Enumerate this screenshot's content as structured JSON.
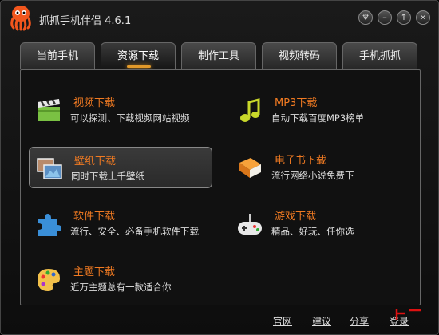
{
  "window": {
    "title": "抓抓手机伴侣 4.6.1"
  },
  "titlebar": {
    "buttons": [
      {
        "name": "skin-button",
        "glyph": "♆"
      },
      {
        "name": "minimize-button",
        "glyph": "–"
      },
      {
        "name": "menu-button",
        "glyph": "↑"
      },
      {
        "name": "close-button",
        "glyph": "×"
      }
    ]
  },
  "tabs": [
    {
      "label": "当前手机"
    },
    {
      "label": "资源下载",
      "active": true
    },
    {
      "label": "制作工具"
    },
    {
      "label": "视频转码"
    },
    {
      "label": "手机抓抓"
    }
  ],
  "items": [
    {
      "title": "视频下载",
      "desc": "可以探测、下载视频网站视频",
      "icon": "clapperboard-icon"
    },
    {
      "title": "MP3下载",
      "desc": "自动下载百度MP3榜单",
      "icon": "music-note-icon"
    },
    {
      "title": "壁纸下载",
      "desc": "同时下载上千壁纸",
      "icon": "wallpaper-icon",
      "selected": true
    },
    {
      "title": "电子书下载",
      "desc": "流行网络小说免费下",
      "icon": "book-icon"
    },
    {
      "title": "软件下载",
      "desc": "流行、安全、必备手机软件下载",
      "icon": "puzzle-icon"
    },
    {
      "title": "游戏下载",
      "desc": "精品、好玩、任你选",
      "icon": "gamepad-icon"
    },
    {
      "title": "主题下载",
      "desc": "近万主题总有一款适合你",
      "icon": "palette-icon"
    }
  ],
  "footer": {
    "links": [
      "官网",
      "建议",
      "分享",
      "登录"
    ]
  },
  "colors": {
    "accent": "#f07a22",
    "background": "#111111"
  }
}
